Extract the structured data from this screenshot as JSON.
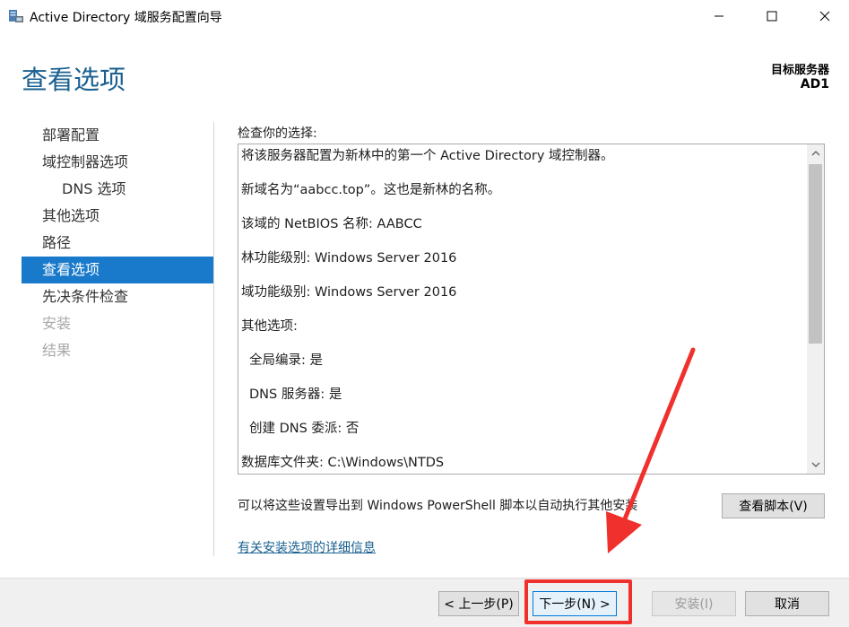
{
  "window": {
    "title": "Active Directory 域服务配置向导"
  },
  "header": {
    "title": "查看选项",
    "target_label": "目标服务器",
    "target_name": "AD1"
  },
  "nav": {
    "items": [
      {
        "label": "部署配置",
        "state": "normal"
      },
      {
        "label": "域控制器选项",
        "state": "normal"
      },
      {
        "label": "DNS 选项",
        "state": "sub"
      },
      {
        "label": "其他选项",
        "state": "normal"
      },
      {
        "label": "路径",
        "state": "normal"
      },
      {
        "label": "查看选项",
        "state": "active"
      },
      {
        "label": "先决条件检查",
        "state": "normal"
      },
      {
        "label": "安装",
        "state": "disabled"
      },
      {
        "label": "结果",
        "state": "disabled"
      }
    ]
  },
  "content": {
    "review_label": "检查你的选择:",
    "review_lines": [
      "将该服务器配置为新林中的第一个 Active Directory 域控制器。",
      "新域名为“aabcc.top”。这也是新林的名称。",
      "该域的 NetBIOS 名称: AABCC",
      "林功能级别: Windows Server 2016",
      "域功能级别: Windows Server 2016",
      "其他选项:",
      "全局编录: 是",
      "DNS 服务器: 是",
      "创建 DNS 委派: 否",
      "数据库文件夹: C:\\Windows\\NTDS"
    ],
    "export_text": "可以将这些设置导出到 Windows PowerShell 脚本以自动执行其他安装",
    "view_script_label": "查看脚本(V)",
    "details_link": "有关安装选项的详细信息"
  },
  "footer": {
    "prev_label": "< 上一步(P)",
    "next_label": "下一步(N) >",
    "install_label": "安装(I)",
    "cancel_label": "取消"
  },
  "colors": {
    "accent": "#1979ca",
    "title_blue": "#1a6090",
    "annotation_red": "#f0302c"
  }
}
